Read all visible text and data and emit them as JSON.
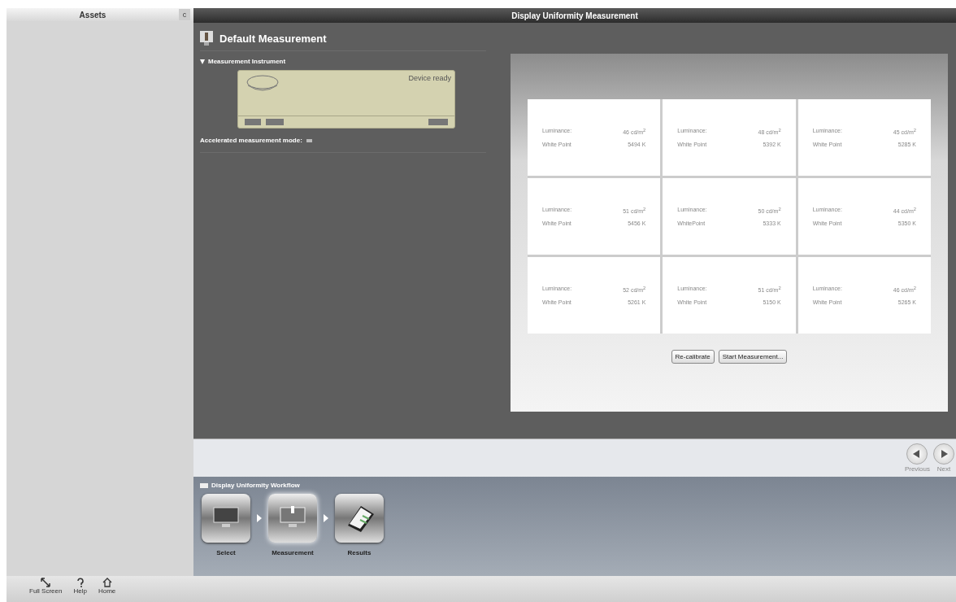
{
  "sidebar": {
    "title": "Assets",
    "corner_button": "c"
  },
  "window": {
    "title": "Display Uniformity Measurement"
  },
  "measurement": {
    "title": "Default Measurement",
    "section": {
      "label": "Measurement Instrument",
      "expanded": true
    },
    "device_status": "Device ready",
    "accelerated": {
      "label": "Accelerated measurement mode:",
      "checked": false
    }
  },
  "grid": [
    {
      "luminance_label": "Luminance:",
      "luminance": "46 cd/m$^{2}$",
      "white_point_label": "White Point",
      "white_point": "5494 K"
    },
    {
      "luminance_label": "Luminance:",
      "luminance": "48 cd/m$^{2}$",
      "white_point_label": "White Point",
      "white_point": "5392 K"
    },
    {
      "luminance_label": "Luminance:",
      "luminance": "45 cd/m$^{2}$",
      "white_point_label": "White Point",
      "white_point": "5285 K"
    },
    {
      "luminance_label": "Luminance:",
      "luminance": "51 cd/m$^{2}$",
      "white_point_label": "White Point",
      "white_point": "5456 K"
    },
    {
      "luminance_label": "Luminance:",
      "luminance": "50 cd/m$^{2}$",
      "white_point_label": "WhitePoint",
      "white_point": "5333 K"
    },
    {
      "luminance_label": "Luminance:",
      "luminance": "44 cd/m$^{2}$",
      "white_point_label": "White Point",
      "white_point": "5350 K"
    },
    {
      "luminance_label": "Luminance:",
      "luminance": "52 cd/m$^{2}$",
      "white_point_label": "White Point",
      "white_point": "5261 K"
    },
    {
      "luminance_label": "Luminance:",
      "luminance": "51 cd/m$^{2}$",
      "white_point_label": "White Point",
      "white_point": "5150 K"
    },
    {
      "luminance_label": "Luminance:",
      "luminance": "46 cd/m$^{2}$",
      "white_point_label": "White Point",
      "white_point": "5265 K"
    }
  ],
  "buttons": [
    "Re-calibrate",
    "Start Measurement..."
  ],
  "nav": [
    {
      "kind": "previous",
      "label": "Previous"
    },
    {
      "kind": "next",
      "label": "Next"
    }
  ],
  "workflow": {
    "title": "Display Uniformity Workflow",
    "steps": [
      {
        "kind": "select",
        "label": "Select",
        "selected": false
      },
      {
        "kind": "measure",
        "label": "Measurement",
        "selected": true
      },
      {
        "kind": "results",
        "label": "Results",
        "selected": false
      }
    ]
  },
  "toolbar": [
    {
      "kind": "fullscreen",
      "label": "Full Screen"
    },
    {
      "kind": "help",
      "label": "Help"
    },
    {
      "kind": "home",
      "label": "Home"
    }
  ]
}
